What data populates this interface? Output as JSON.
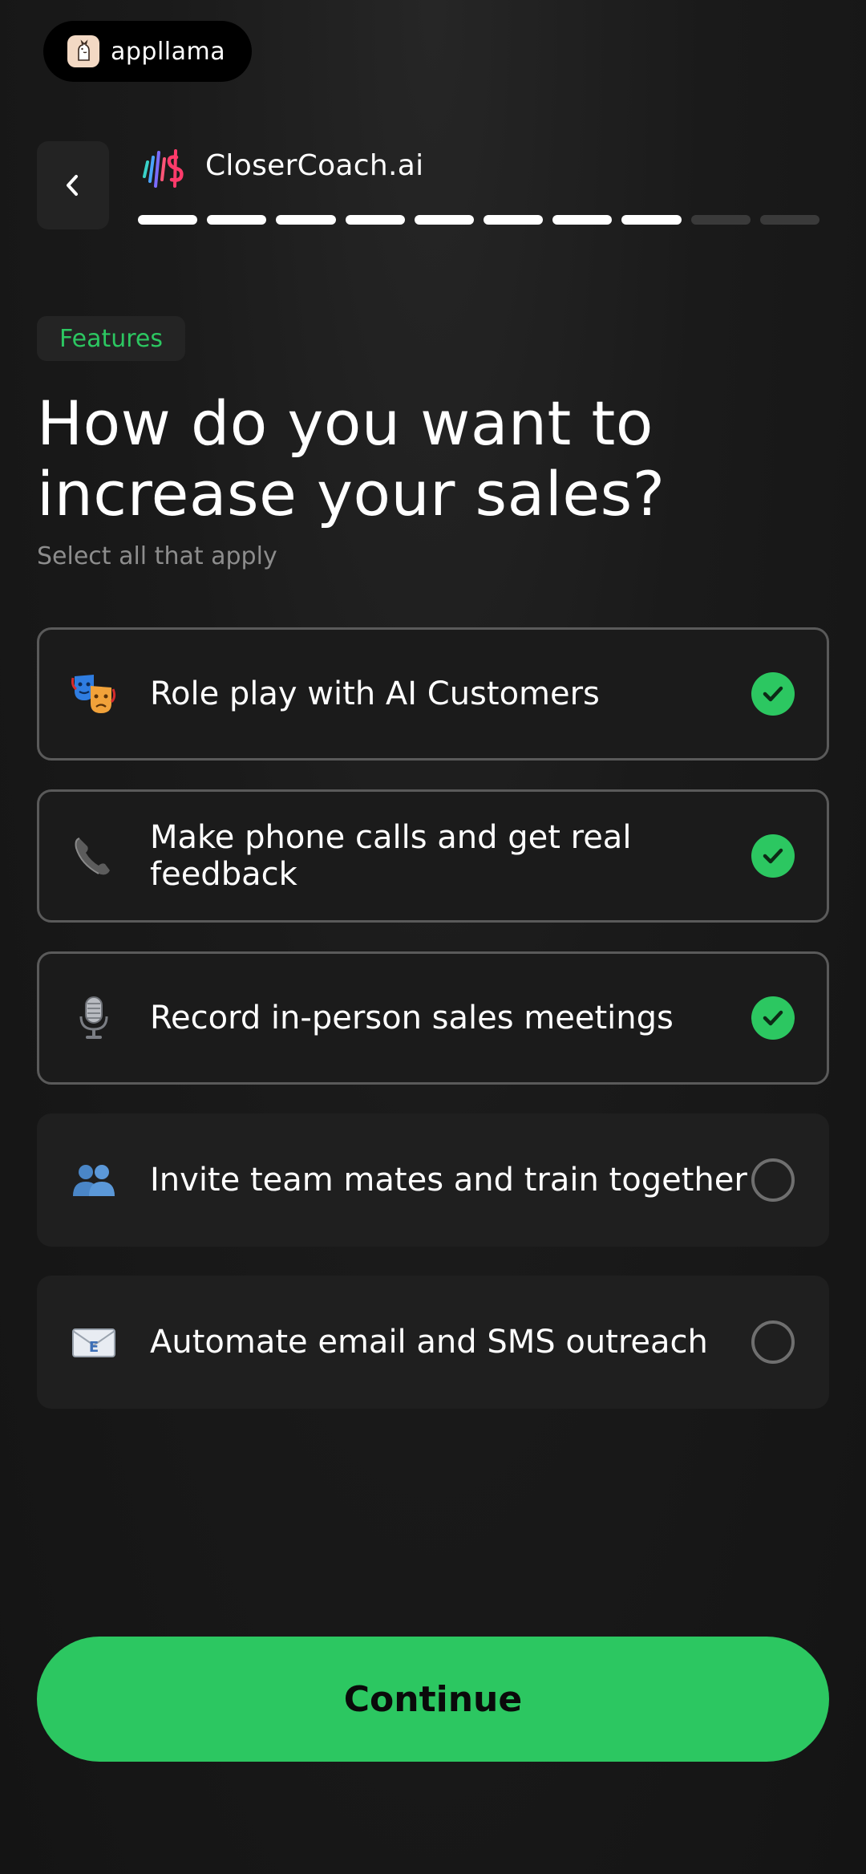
{
  "watermark": {
    "brand": "appllama"
  },
  "header": {
    "app_name": "CloserCoach.ai",
    "progress": {
      "completed": 8,
      "total": 10
    }
  },
  "tag": "Features",
  "title": "How do you want to increase your sales?",
  "subtitle": "Select all that apply",
  "options": [
    {
      "icon": "theater-masks-icon",
      "label": "Role play with AI Customers",
      "selected": true
    },
    {
      "icon": "phone-icon",
      "label": "Make phone calls and get real feedback",
      "selected": true
    },
    {
      "icon": "microphone-icon",
      "label": "Record in-person sales meetings",
      "selected": true
    },
    {
      "icon": "people-icon",
      "label": "Invite team mates and train together",
      "selected": false
    },
    {
      "icon": "email-icon",
      "label": "Automate email and SMS outreach",
      "selected": false
    }
  ],
  "continue_label": "Continue",
  "colors": {
    "accent": "#2cc761",
    "background": "#1a1a1a",
    "card": "#1f1f1f",
    "card_border_selected": "#5a5a5a"
  }
}
